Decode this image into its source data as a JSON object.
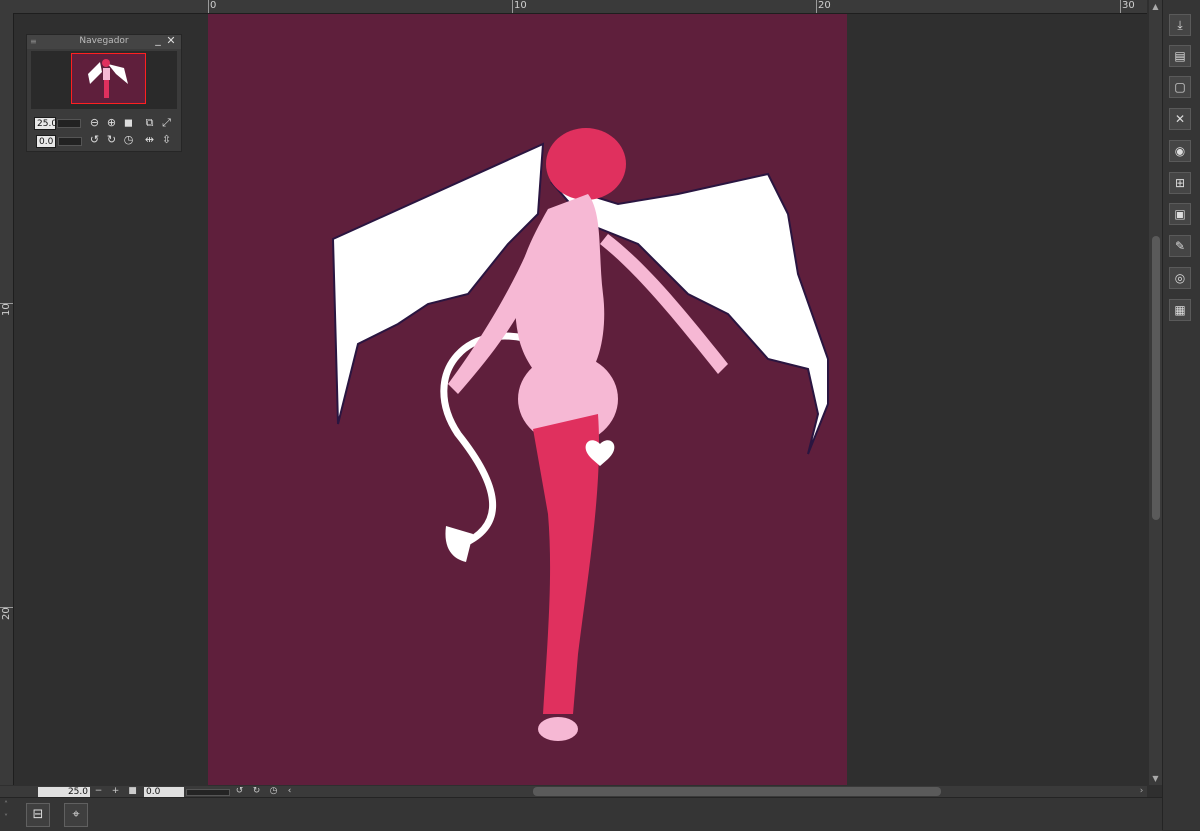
{
  "ruler": {
    "top_labels": [
      "0",
      "10",
      "20",
      "30"
    ],
    "left_labels": [
      "10",
      "20"
    ]
  },
  "navigator": {
    "title": "Navegador",
    "zoom_value": "25.0",
    "rotation_value": "0.0",
    "icons": {
      "zoom_out": "zoom-out-icon",
      "zoom_in": "zoom-in-icon",
      "stop": "stop-icon",
      "fit_page": "fit-page-icon",
      "fit_window": "fit-window-icon",
      "rotate_left": "rotate-left-icon",
      "rotate_right": "rotate-right-icon",
      "reset_rotation": "reset-rotation-icon",
      "flip_horizontal": "flip-horizontal-icon",
      "flip_vertical": "flip-vertical-icon"
    }
  },
  "status_bar": {
    "zoom_value": "25.0",
    "minus": "−",
    "plus": "+",
    "rotation_value": "0.0"
  },
  "canvas": {
    "background_color": "#2f2f2f",
    "artboard_color": "#5f1f3c"
  },
  "right_toolbar": {
    "buttons": [
      "import-icon",
      "layer-icon",
      "canvas-icon",
      "close-file-icon",
      "camera-icon",
      "transform-icon",
      "frame-icon",
      "edit-icon",
      "snapshot-icon",
      "grid-icon"
    ]
  },
  "bottom_toolbar": {
    "buttons": [
      "panel-toggle-icon",
      "target-icon"
    ]
  }
}
